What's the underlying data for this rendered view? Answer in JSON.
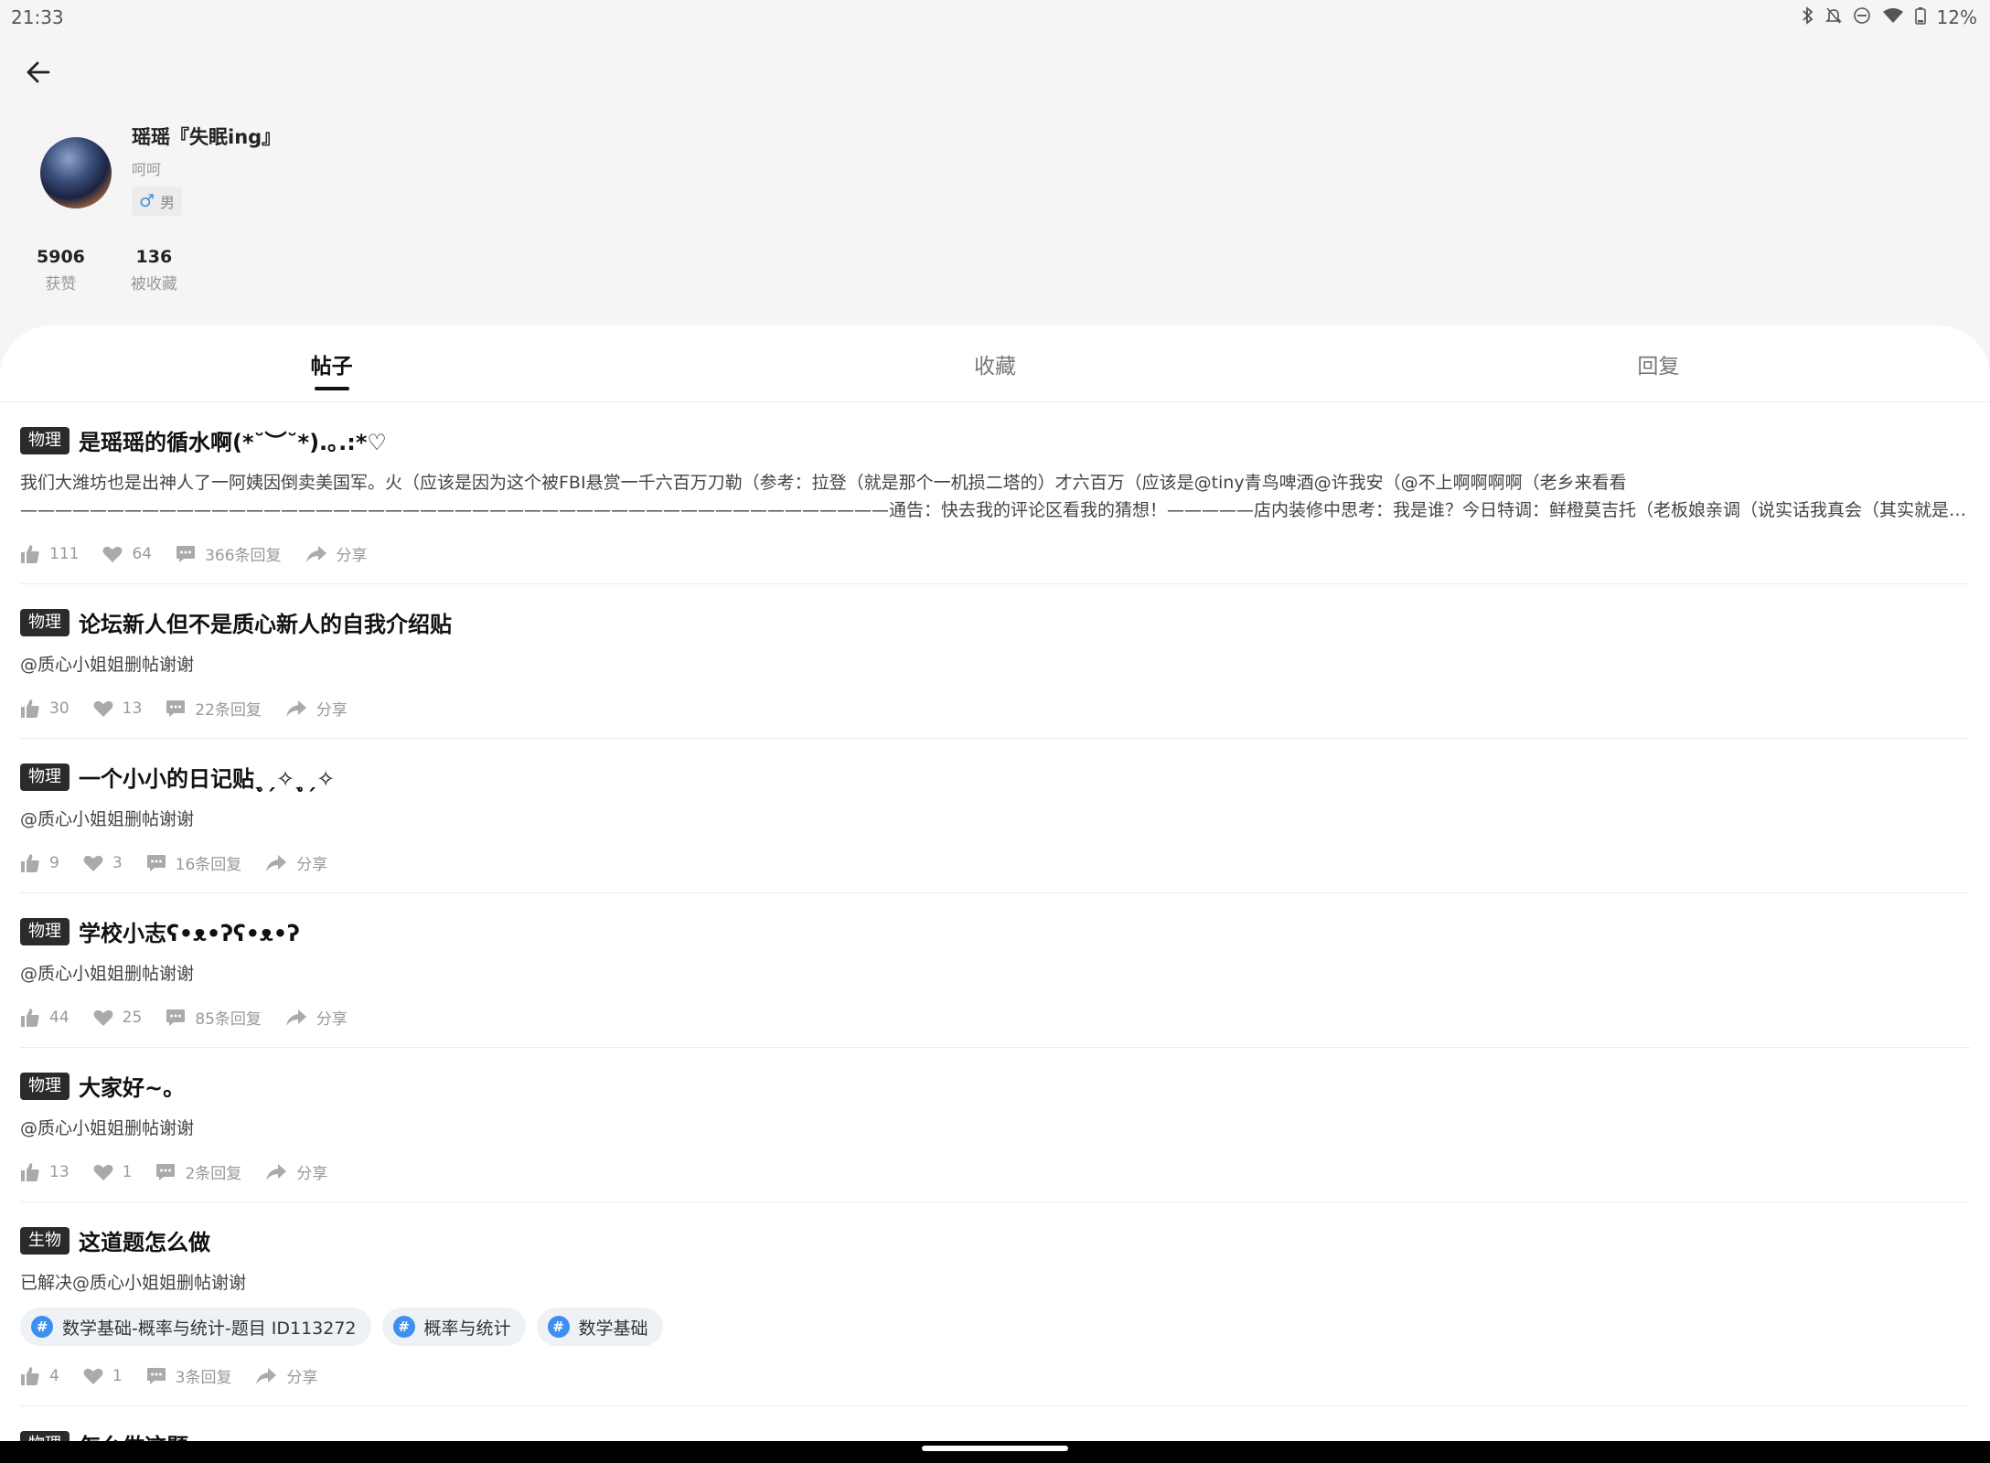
{
  "status_bar": {
    "time": "21:33",
    "icons": [
      "bluetooth-icon",
      "notifications-off-icon",
      "dnd-icon",
      "wifi-icon",
      "battery-icon"
    ],
    "battery": "12%"
  },
  "profile": {
    "username": "瑶瑶『失眠ing』",
    "signature": "呵呵",
    "gender_symbol": "♂",
    "gender_label": "男",
    "stats": [
      {
        "num": "5906",
        "label": "获赞"
      },
      {
        "num": "136",
        "label": "被收藏"
      }
    ]
  },
  "tabs": [
    "帖子",
    "收藏",
    "回复"
  ],
  "active_tab": 0,
  "posts": [
    {
      "tag": "物理",
      "title": "是瑶瑶的循水啊(*˘︶˘*).｡.:*♡",
      "body": [
        "我们大潍坊也是出神人了一阿姨因倒卖美国军。火（应该是因为这个被FBI悬赏一千六百万刀勒（参考：拉登（就是那个一机损二塔的）才六百万（应该是@tiny青鸟啤酒@许我安（@不上啊啊啊啊（老乡来看看",
        "——————————————————————————————————————————————————通告：快去我的评论区看我的猜想！—————店内装修中思考：我是谁？今日特调：鲜橙莫吉托（老板娘亲调（说实话我真会（其实就是那我妈的鲜…"
      ],
      "likes": "111",
      "favs": "64",
      "replies": "366条回复",
      "share": "分享"
    },
    {
      "tag": "物理",
      "title": "论坛新人但不是质心新人的自我介绍贴",
      "body": [
        "@质心小姐姐删帖谢谢"
      ],
      "likes": "30",
      "favs": "13",
      "replies": "22条回复",
      "share": "分享"
    },
    {
      "tag": "物理",
      "title": "一个小小的日记贴ˎ̥ˏ✧ˎ̥ˏ✧",
      "body": [
        "@质心小姐姐删帖谢谢"
      ],
      "likes": "9",
      "favs": "3",
      "replies": "16条回复",
      "share": "分享"
    },
    {
      "tag": "物理",
      "title": "学校小志ʕ•ᴥ•ʔʕ•ᴥ•ʔ",
      "body": [
        "@质心小姐姐删帖谢谢"
      ],
      "likes": "44",
      "favs": "25",
      "replies": "85条回复",
      "share": "分享"
    },
    {
      "tag": "物理",
      "title": "大家好~。",
      "body": [
        "@质心小姐姐删帖谢谢"
      ],
      "likes": "13",
      "favs": "1",
      "replies": "2条回复",
      "share": "分享"
    },
    {
      "tag": "生物",
      "title": "这道题怎么做",
      "body": [
        "已解决@质心小姐姐删帖谢谢"
      ],
      "topics": [
        "数学基础-概率与统计-题目 ID113272",
        "概率与统计",
        "数学基础"
      ],
      "likes": "4",
      "favs": "1",
      "replies": "3条回复",
      "share": "分享"
    },
    {
      "tag": "物理",
      "title": "怎么做这题",
      "body": []
    }
  ]
}
